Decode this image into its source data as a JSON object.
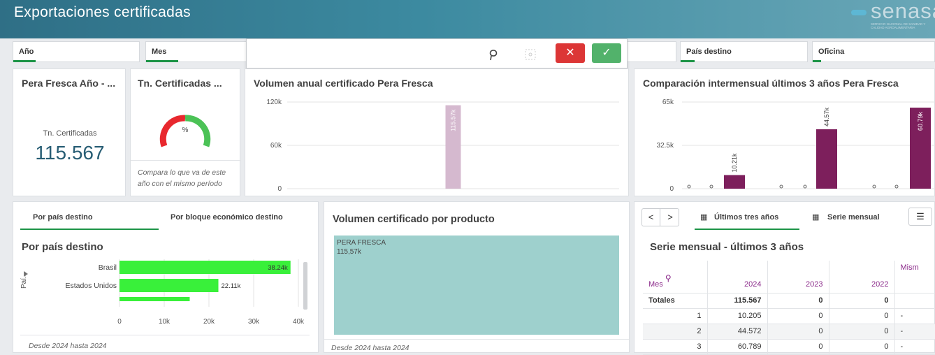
{
  "header": {
    "title": "Exportaciones certificadas",
    "logo": "senasa",
    "logo_sub": "SERVICIO NACIONAL DE SANIDAD Y CALIDAD AGROALIMENTARIA"
  },
  "filters": {
    "anio": "Año",
    "mes": "Mes",
    "pais": "País destino",
    "oficina": "Oficina"
  },
  "kpi": {
    "title": "Pera Fresca Año - ...",
    "label": "Tn. Certificadas",
    "value": "115.567"
  },
  "gauge": {
    "title": "Tn. Certificadas ...",
    "symbol": "%",
    "note": "Compara lo que va de este año con el mismo período"
  },
  "annual": {
    "title": "Volumen anual certificado Pera Fresca"
  },
  "monthly": {
    "title": "Comparación intermensual últimos 3 años Pera Fresca"
  },
  "country": {
    "tab1": "Por país destino",
    "tab2": "Por bloque económico destino",
    "subtitle": "Por país destino",
    "axis_label": "Paí...",
    "footer": "Desde 2024 hasta 2024"
  },
  "product": {
    "title": "Volumen certificado por producto",
    "tile_name": "PERA FRESCA",
    "tile_value": "115,57k",
    "footer": "Desde 2024 hasta 2024"
  },
  "table": {
    "tab1": "Últimos tres años",
    "tab2": "Serie mensual",
    "title": "Serie mensual - últimos 3 años",
    "headers": [
      "Mes",
      "2024",
      "2023",
      "2022",
      "Mism"
    ],
    "totals": [
      "Totales",
      "115.567",
      "0",
      "0",
      ""
    ],
    "rows": [
      [
        "1",
        "10.205",
        "0",
        "0",
        "-"
      ],
      [
        "2",
        "44.572",
        "0",
        "0",
        "-"
      ],
      [
        "3",
        "60.789",
        "0",
        "0",
        "-"
      ]
    ]
  },
  "chart_data": [
    {
      "type": "bar",
      "title": "Volumen anual certificado Pera Fresca",
      "categories": [
        ""
      ],
      "values": [
        115570
      ],
      "labels": [
        "115.57k"
      ],
      "ylim": [
        0,
        120000
      ],
      "yticks": [
        "0",
        "60k",
        "120k"
      ],
      "color": "#d5b9cf"
    },
    {
      "type": "bar",
      "title": "Comparación intermensual últimos 3 años Pera Fresca",
      "categories": [
        "",
        "",
        "",
        "",
        "",
        "",
        "",
        "",
        ""
      ],
      "values": [
        0,
        0,
        10210,
        0,
        0,
        44570,
        0,
        0,
        60790
      ],
      "labels": [
        "",
        "",
        "10.21k",
        "",
        "",
        "44.57k",
        "",
        "",
        "60.79k"
      ],
      "ylim": [
        0,
        65000
      ],
      "yticks": [
        "0",
        "32.5k",
        "65k"
      ],
      "color": "#7d1f5c"
    },
    {
      "type": "bar",
      "orientation": "horizontal",
      "title": "Por país destino",
      "categories": [
        "Brasil",
        "Estados Unidos",
        ""
      ],
      "values": [
        38240,
        22110,
        15700
      ],
      "labels": [
        "38.24k",
        "22.11k",
        ""
      ],
      "xlim": [
        0,
        40000
      ],
      "xticks": [
        "0",
        "10k",
        "20k",
        "30k",
        "40k"
      ],
      "color": "#39f03a"
    }
  ]
}
